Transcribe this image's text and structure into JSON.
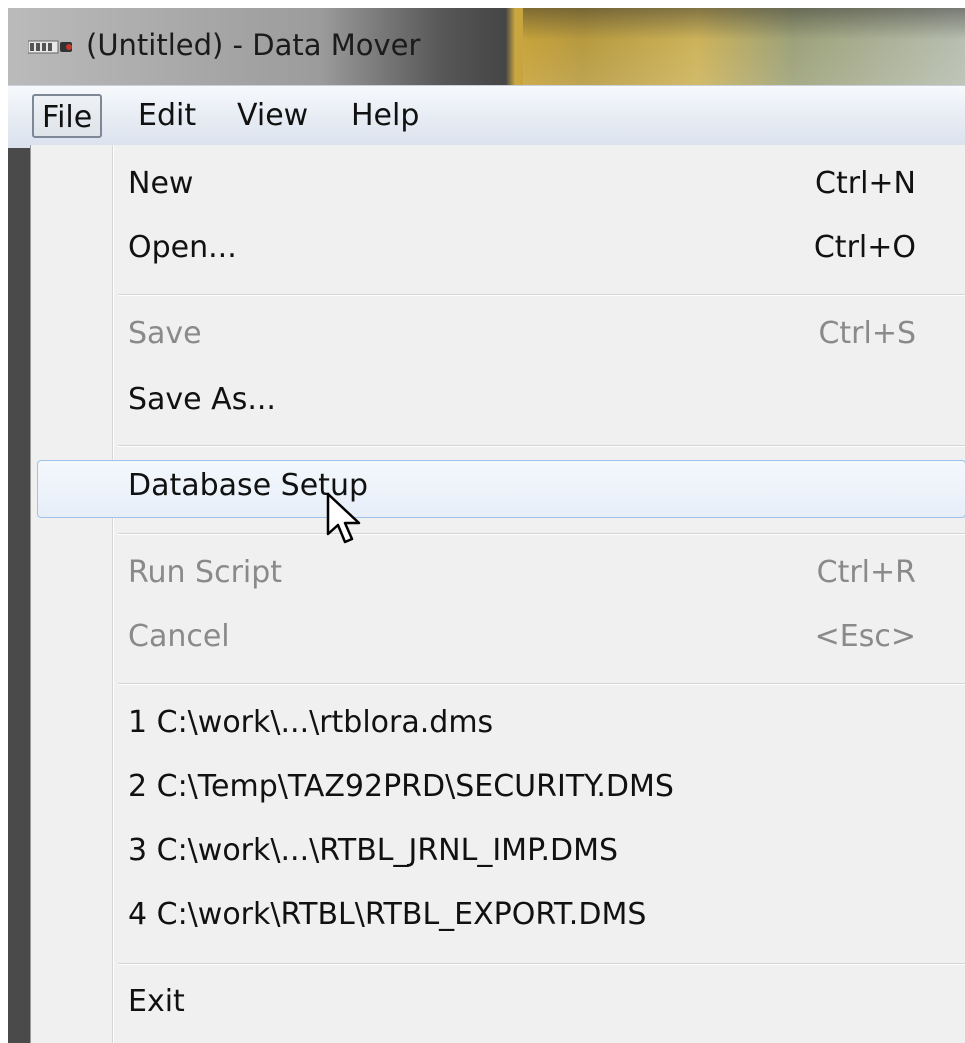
{
  "window": {
    "title": "(Untitled) - Data Mover",
    "icon": "app-icon"
  },
  "menubar": {
    "items": [
      {
        "label": "File",
        "active": true
      },
      {
        "label": "Edit"
      },
      {
        "label": "View"
      },
      {
        "label": "Help"
      }
    ]
  },
  "file_menu": {
    "new": {
      "label": "New",
      "shortcut": "Ctrl+N"
    },
    "open": {
      "label": "Open...",
      "shortcut": "Ctrl+O"
    },
    "save": {
      "label": "Save",
      "shortcut": "Ctrl+S",
      "enabled": false
    },
    "save_as": {
      "label": "Save As..."
    },
    "database_setup": {
      "label": "Database Setup",
      "highlighted": true
    },
    "run_script": {
      "label": "Run Script",
      "shortcut": "Ctrl+R",
      "enabled": false
    },
    "cancel": {
      "label": "Cancel",
      "shortcut": "<Esc>",
      "enabled": false
    },
    "recent_files": [
      "1 C:\\work\\...\\rtblora.dms",
      "2 C:\\Temp\\TAZ92PRD\\SECURITY.DMS",
      "3 C:\\work\\...\\RTBL_JRNL_IMP.DMS",
      "4 C:\\work\\RTBL\\RTBL_EXPORT.DMS"
    ],
    "exit": {
      "label": "Exit"
    }
  },
  "colors": {
    "menu_background": "#f0f0f0",
    "hover_border": "#9ec3ea",
    "disabled_text": "#8a8a8a"
  }
}
